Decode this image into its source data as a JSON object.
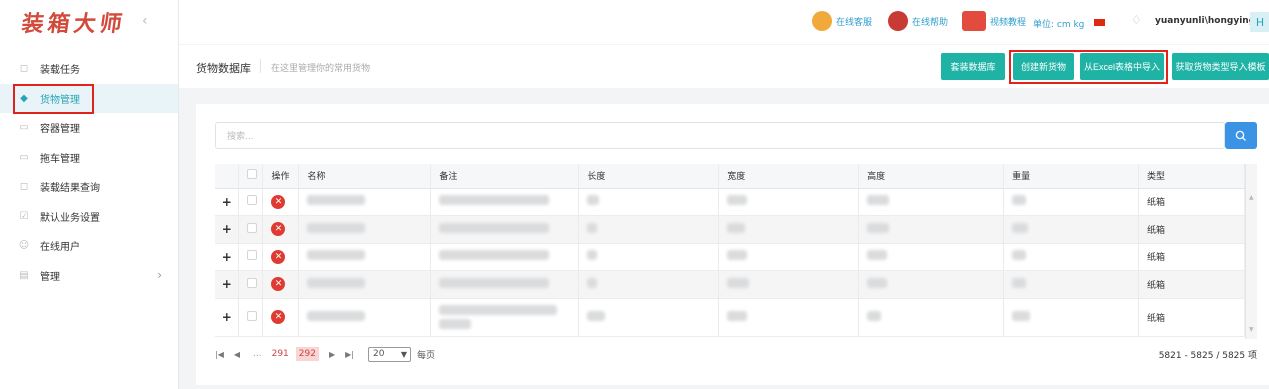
{
  "logo": "装箱大师",
  "sidebar": {
    "items": [
      {
        "label": "装载任务"
      },
      {
        "label": "货物管理"
      },
      {
        "label": "容器管理"
      },
      {
        "label": "拖车管理"
      },
      {
        "label": "装载结果查询"
      },
      {
        "label": "默认业务设置"
      },
      {
        "label": "在线用户"
      },
      {
        "label": "管理"
      }
    ]
  },
  "topbar": {
    "service": "在线客服",
    "help": "在线帮助",
    "video": "视频教程",
    "unit": "单位: cm kg",
    "username": "yuanyunli\\hongying",
    "avatar_letter": "H"
  },
  "header": {
    "title": "货物数据库",
    "desc": "在这里管理你的常用货物",
    "buttons": [
      "套装数据库",
      "创建新货物",
      "从Excel表格中导入",
      "获取货物类型导入模板"
    ]
  },
  "search": {
    "placeholder": "搜索..."
  },
  "table": {
    "columns": [
      "操作",
      "名称",
      "备注",
      "长度",
      "宽度",
      "高度",
      "重量",
      "类型"
    ],
    "rows": [
      {
        "type": "纸箱"
      },
      {
        "type": "纸箱"
      },
      {
        "type": "纸箱"
      },
      {
        "type": "纸箱"
      },
      {
        "type": "纸箱"
      }
    ]
  },
  "pager": {
    "ellipsis": "...",
    "pages": [
      "291",
      "292"
    ],
    "page_size": "20",
    "per_page_label": "每页",
    "info": "5821 - 5825 / 5825 项"
  },
  "colors": {
    "accent": "#1fb3a6",
    "brand_red": "#d14a3c",
    "highlight_box": "#e0241c",
    "search_button": "#3a93e5"
  }
}
